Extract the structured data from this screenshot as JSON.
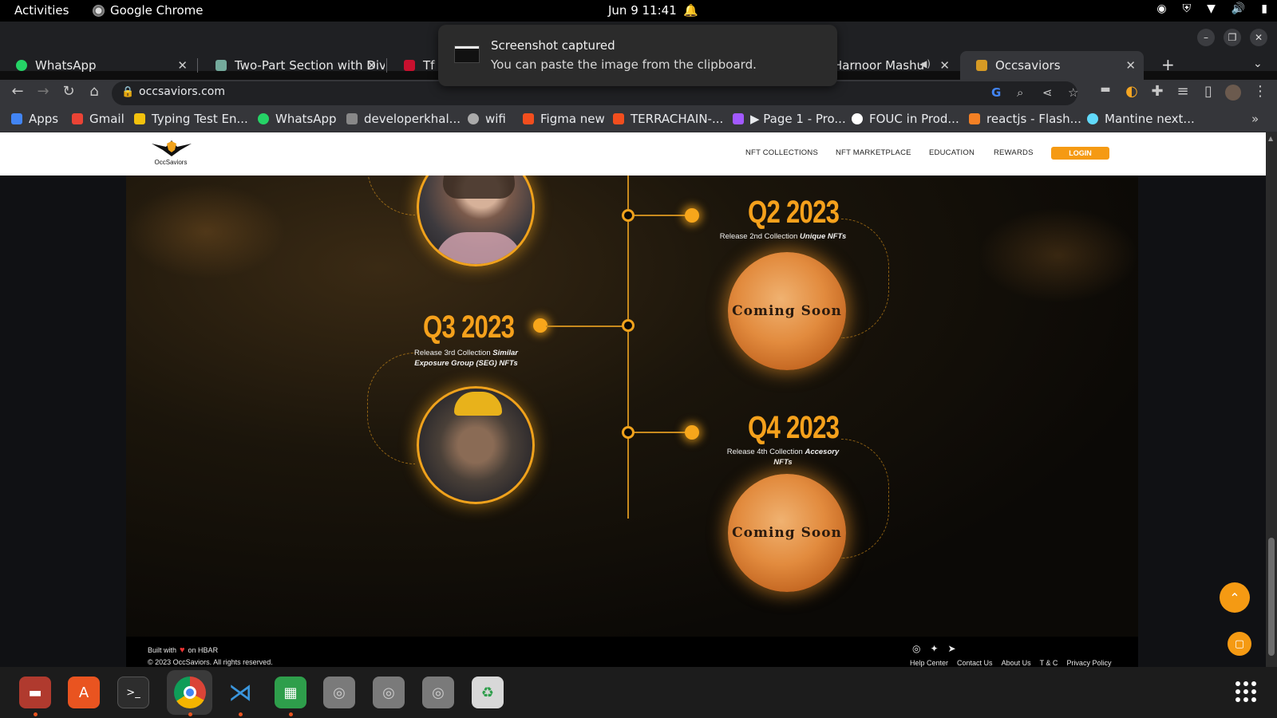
{
  "topbar": {
    "activities": "Activities",
    "app_name": "Google Chrome",
    "clock": "Jun 9  11:41"
  },
  "notification": {
    "title": "Screenshot captured",
    "body": "You can paste the image from the clipboard."
  },
  "tabs": [
    {
      "label": "WhatsApp",
      "color": "#25d366"
    },
    {
      "label": "Two-Part Section with Div",
      "color": "#74aa9c"
    },
    {
      "label": "TfN",
      "color": "#c8102e"
    },
    {
      "label": "Harnoor Mashu",
      "color": "#ff0000"
    },
    {
      "label": "Occsaviors",
      "color": "#d69a24"
    }
  ],
  "toolbar": {
    "url": "occsaviors.com"
  },
  "bookmarks": [
    {
      "label": "Apps",
      "color": "#4285f4"
    },
    {
      "label": "Gmail",
      "color": "#ea4335"
    },
    {
      "label": "Typing Test En...",
      "color": "#f4c20d"
    },
    {
      "label": "WhatsApp",
      "color": "#25d366"
    },
    {
      "label": "developerkhal...",
      "color": "#888888"
    },
    {
      "label": "wifi",
      "color": "#aaaaaa"
    },
    {
      "label": "Figma new",
      "color": "#f24e1e"
    },
    {
      "label": "TERRACHAIN-...",
      "color": "#f24e1e"
    },
    {
      "label": "▶ Page 1 - Pro...",
      "color": "#a259ff"
    },
    {
      "label": "FOUC in Prod...",
      "color": "#ffffff"
    },
    {
      "label": "reactjs - Flash...",
      "color": "#f48024"
    },
    {
      "label": "Mantine next...",
      "color": "#61dafb"
    }
  ],
  "site": {
    "logo_text": "OccSaviors",
    "nav": [
      "NFT COLLECTIONS",
      "NFT MARKETPLACE",
      "EDUCATION",
      "REWARDS"
    ],
    "login": "LOGIN",
    "roadmap": [
      {
        "quarter": "Q2 2023",
        "desc_plain": "Release 2nd Collection ",
        "desc_em": "Unique NFTs",
        "coin": "Coming Soon"
      },
      {
        "quarter": "Q3 2023",
        "desc_plain": "Release 3rd Collection ",
        "desc_em": "Similar Exposure Group (SEG) NFTs"
      },
      {
        "quarter": "Q4 2023",
        "desc_plain": "Release 4th Collection ",
        "desc_em": "Accesory NFTs",
        "coin": "Coming Soon"
      }
    ],
    "footer": {
      "built_prefix": "Built with",
      "built_suffix": "on HBAR",
      "copyright": "© 2023 OccSaviors. All rights reserved.",
      "links": [
        "Help Center",
        "Contact Us",
        "About Us",
        "T & C",
        "Privacy Policy"
      ]
    }
  },
  "accent_color": "#f59a13"
}
